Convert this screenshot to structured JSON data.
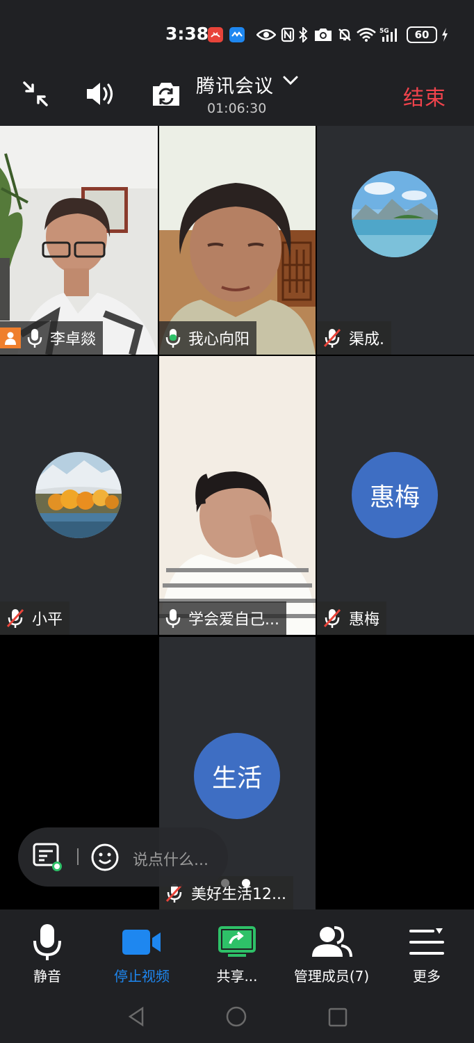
{
  "status_bar": {
    "time": "3:38",
    "battery": "60"
  },
  "header": {
    "title": "腾讯会议",
    "timer": "01:06:30",
    "end_label": "结束"
  },
  "participants": [
    {
      "name": "李卓燚",
      "mic": "on"
    },
    {
      "name": "我心向阳",
      "mic": "speaking"
    },
    {
      "name": "渠成.",
      "mic": "muted"
    },
    {
      "name": "小平",
      "mic": "muted"
    },
    {
      "name": "学会爱自己...",
      "mic": "on"
    },
    {
      "name": "惠梅",
      "mic": "muted",
      "avatar_text": "惠梅"
    },
    {
      "name": "美好生活12...",
      "mic": "muted",
      "avatar_text": "生活"
    }
  ],
  "chat": {
    "placeholder": "说点什么..."
  },
  "toolbar": {
    "mute_label": "静音",
    "stop_video_label": "停止视频",
    "share_label": "共享...",
    "manage_members_label": "管理成员(7)",
    "more_label": "更多"
  },
  "colors": {
    "accent_blue": "#1e87f0",
    "end_red": "#f0434c",
    "speaking_green": "#2ec168",
    "avatar_blue": "#3e6ec3"
  }
}
